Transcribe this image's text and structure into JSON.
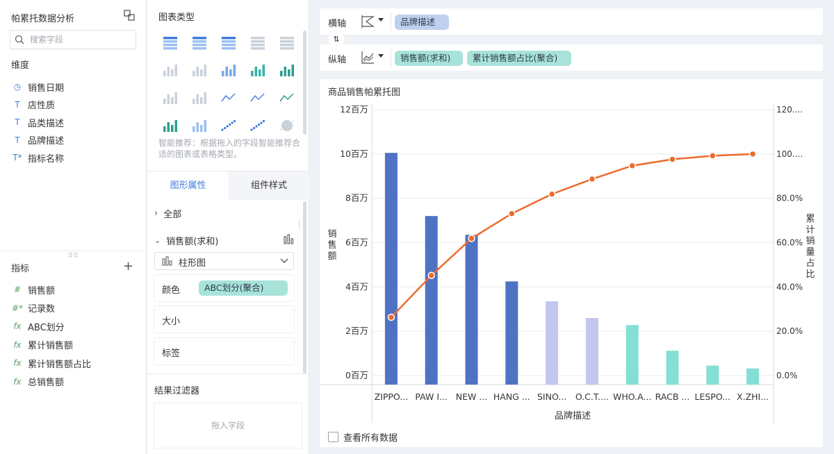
{
  "left_panel": {
    "title": "帕累托数据分析",
    "search_placeholder": "搜索字段",
    "dimensions_label": "维度",
    "dimensions": [
      {
        "icon": "clock-icon",
        "glyph": "◷",
        "label": "销售日期"
      },
      {
        "icon": "text-type-icon",
        "glyph": "T",
        "label": "店性质"
      },
      {
        "icon": "text-type-icon",
        "glyph": "T",
        "label": "品类描述"
      },
      {
        "icon": "text-type-icon",
        "glyph": "T",
        "label": "品牌描述"
      },
      {
        "icon": "text-type-star-icon",
        "glyph": "T*",
        "label": "指标名称"
      }
    ],
    "metrics_label": "指标",
    "metrics": [
      {
        "icon": "hash-icon",
        "glyph": "#",
        "label": "销售额"
      },
      {
        "icon": "hash-star-icon",
        "glyph": "#*",
        "label": "记录数"
      },
      {
        "icon": "fx-icon",
        "glyph": "fx",
        "label": "ABC划分"
      },
      {
        "icon": "fx-icon",
        "glyph": "fx",
        "label": "累计销售额"
      },
      {
        "icon": "fx-icon",
        "glyph": "fx",
        "label": "累计销售额占比"
      },
      {
        "icon": "fx-icon",
        "glyph": "fx",
        "label": "总销售额"
      }
    ]
  },
  "middle_panel": {
    "chart_types_title": "图表类型",
    "hint": "智能推荐：根据拖入的字段智能推荐合适的图表或表格类型。",
    "tabs": [
      "图形属性",
      "组件样式"
    ],
    "all_label": "全部",
    "measure_label": "销售额(求和)",
    "chart_kind": "柱形图",
    "color_label": "颜色",
    "color_field": "ABC划分(聚合)",
    "size_label": "大小",
    "tag_label": "标签",
    "filter_title": "结果过滤器",
    "drop_hint": "拖入字段"
  },
  "axes": {
    "x_label": "横轴",
    "x_field": "品牌描述",
    "y_label": "纵轴",
    "y_fields": [
      "销售额(求和)",
      "累计销售额占比(聚合)"
    ],
    "swap_glyph": "⇅"
  },
  "chart": {
    "title": "商品销售帕累托图",
    "show_all_label": "查看所有数据",
    "colors": {
      "A": "#4f72c4",
      "B": "#c3c7ee",
      "C": "#84dfd5",
      "line": "#ec6a2c"
    }
  },
  "chart_data": {
    "type": "bar+line",
    "title": "商品销售帕累托图",
    "xlabel": "品牌描述",
    "ylabel": "销售额",
    "y2label": "累计销量占比",
    "categories": [
      "ZIPPO...",
      "PAW I...",
      "NEW ...",
      "HANG ...",
      "SINO...",
      "O.C.T....",
      "WHO.A...",
      "RACB ...",
      "LESPO...",
      "X.ZHI..."
    ],
    "bar_values": [
      10.05,
      7.2,
      6.35,
      4.25,
      3.35,
      2.6,
      2.28,
      1.12,
      0.45,
      0.32
    ],
    "bar_class": [
      "A",
      "A",
      "A",
      "A",
      "B",
      "B",
      "C",
      "C",
      "C",
      "C"
    ],
    "line_values": [
      26.3,
      45.2,
      61.9,
      73.1,
      81.9,
      88.7,
      94.7,
      97.6,
      99.2,
      100
    ],
    "y_ticks": [
      "0百万",
      "2百万",
      "4百万",
      "6百万",
      "8百万",
      "10百万",
      "12百万"
    ],
    "y2_ticks": [
      "0.0%",
      "20.0%",
      "40.0%",
      "60.0%",
      "80.0%",
      "100....",
      "120...."
    ],
    "ylim": [
      0,
      12
    ],
    "y2lim": [
      0,
      120
    ],
    "grid": true
  }
}
